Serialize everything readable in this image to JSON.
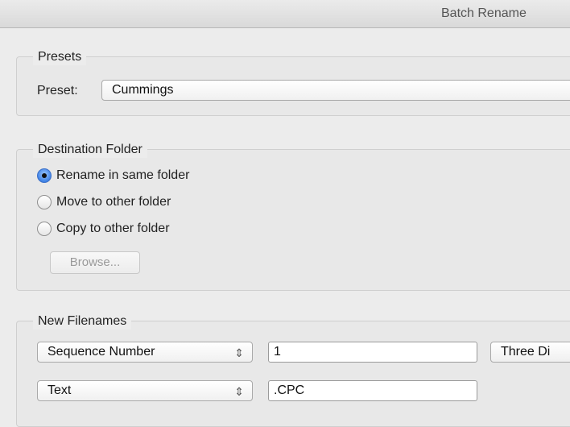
{
  "window": {
    "title": "Batch Rename"
  },
  "presets": {
    "legend": "Presets",
    "label": "Preset:",
    "value": "Cummings"
  },
  "destination": {
    "legend": "Destination Folder",
    "options": [
      {
        "label": "Rename in same folder",
        "checked": true
      },
      {
        "label": "Move to other folder",
        "checked": false
      },
      {
        "label": "Copy to other folder",
        "checked": false
      }
    ],
    "browse_label": "Browse..."
  },
  "new_filenames": {
    "legend": "New Filenames",
    "rows": [
      {
        "type": "Sequence Number",
        "value": "1",
        "option": "Three Di"
      },
      {
        "type": "Text",
        "value": ".CPC"
      }
    ]
  }
}
